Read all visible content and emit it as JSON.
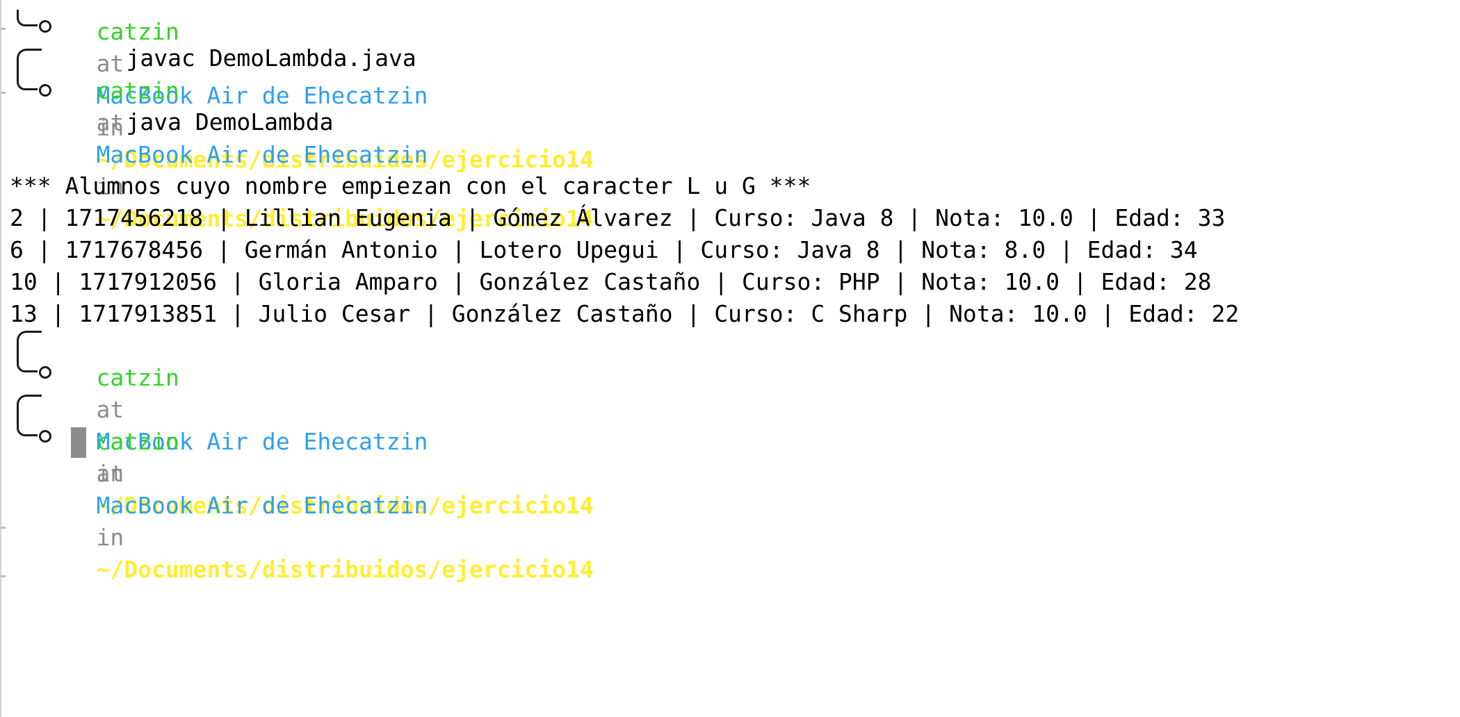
{
  "prompt": {
    "user": "catzin",
    "at": "at",
    "host": "MacBook Air de Ehecatzin",
    "in": "in",
    "path": "~/Documents/distribuidos/ejercicio14"
  },
  "commands": [
    "javac DemoLambda.java",
    "java DemoLambda"
  ],
  "output": {
    "header": "*** Alumnos cuyo nombre empiezan con el caracter L u G ***",
    "rows": [
      "2 | 1717456218 | Lillian Eugenia | Gómez Álvarez | Curso: Java 8 | Nota: 10.0 | Edad: 33",
      "6 | 1717678456 | Germán Antonio | Lotero Upegui | Curso: Java 8 | Nota: 8.0 | Edad: 34",
      "10 | 1717912056 | Gloria Amparo | González Castaño | Curso: PHP | Nota: 10.0 | Edad: 28",
      "13 | 1717913851 | Julio Cesar | González Castaño | Curso: C Sharp | Nota: 10.0 | Edad: 22"
    ]
  },
  "colors": {
    "user": "#34d327",
    "keyword": "#8c8c8c",
    "host": "#2e9ff0",
    "path": "#ffee33",
    "cursor": "#8c8c8c"
  }
}
